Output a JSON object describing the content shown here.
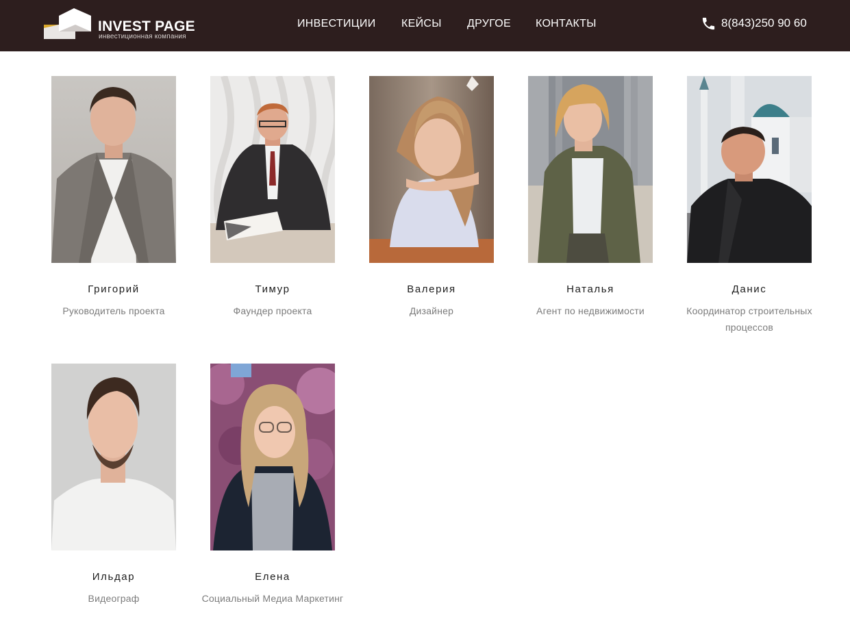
{
  "header": {
    "logo_title": "INVEST PAGE",
    "logo_subtitle": "инвестиционная компания",
    "nav": [
      {
        "label": "ИНВЕСТИЦИИ"
      },
      {
        "label": "КЕЙСЫ"
      },
      {
        "label": "ДРУГОЕ"
      },
      {
        "label": "КОНТАКТЫ"
      }
    ],
    "phone": "8(843)250 90 60",
    "phone_icon": "phone-icon",
    "colors": {
      "background": "#2d1e1e",
      "logo_accent": "#d9a62a"
    }
  },
  "team": [
    {
      "name": "Григорий",
      "role": "Руководитель проекта"
    },
    {
      "name": "Тимур",
      "role": "Фаундер проекта"
    },
    {
      "name": "Валерия",
      "role": "Дизайнер"
    },
    {
      "name": "Наталья",
      "role": "Агент по недвижимости"
    },
    {
      "name": "Данис",
      "role": "Координатор строительных процессов"
    },
    {
      "name": "Ильдар",
      "role": "Видеограф"
    },
    {
      "name": "Елена",
      "role": "Социальный Медиа Маркетинг"
    }
  ]
}
